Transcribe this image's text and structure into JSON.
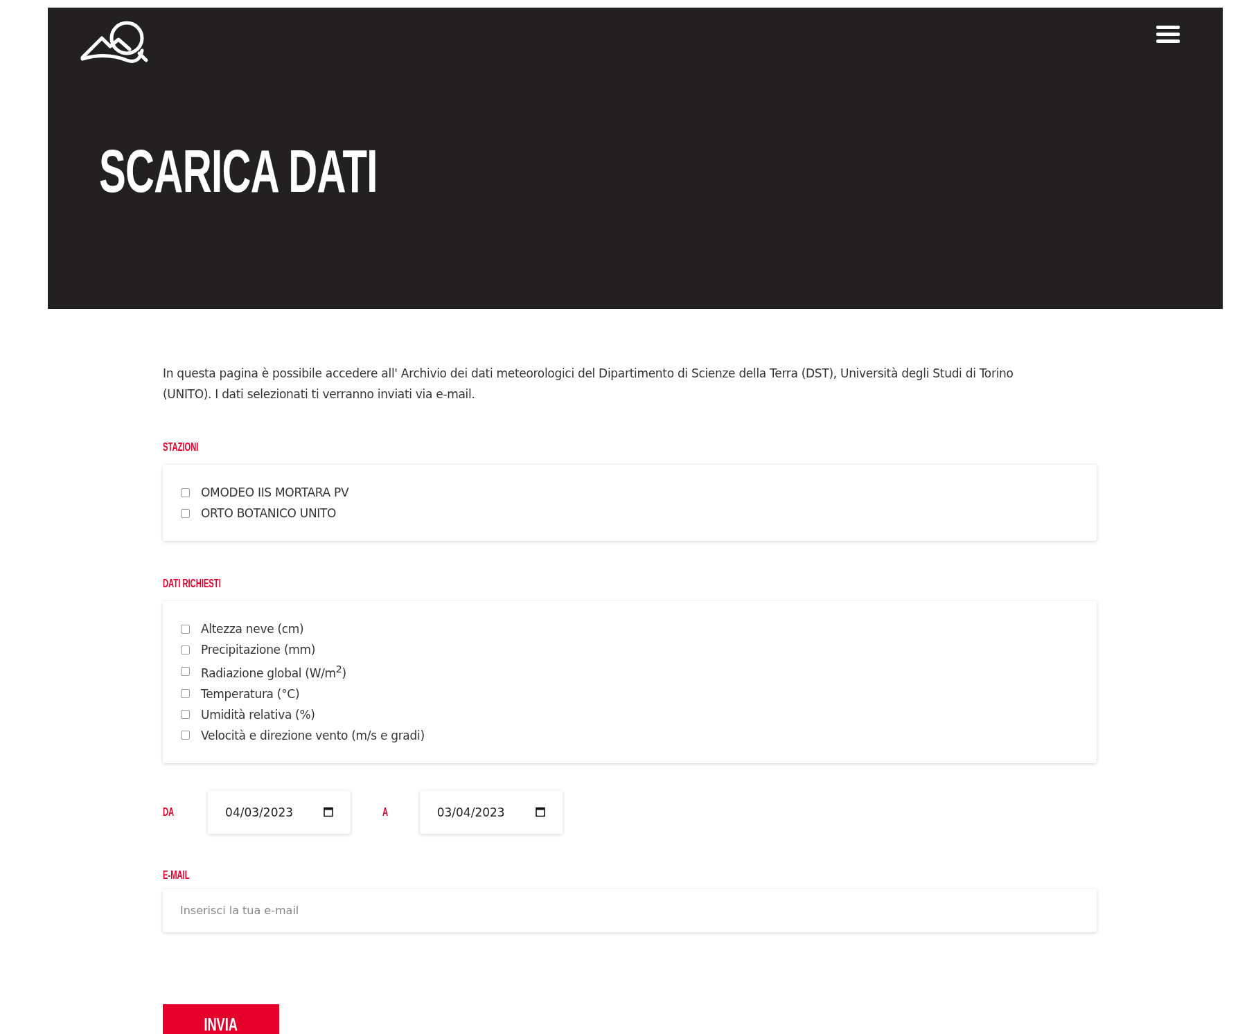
{
  "header": {
    "title": "SCARICA DATI"
  },
  "intro": "In questa pagina è possibile accedere all' Archivio dei dati meteorologici del Dipartimento di Scienze della Terra (DST), Università degli Studi di Torino (UNITO). I dati selezionati ti verranno inviati via e-mail.",
  "groups": [
    {
      "label": "STAZIONI",
      "options": [
        {
          "label": "OMODEO IIS MORTARA PV",
          "checked": false
        },
        {
          "label": "ORTO BOTANICO UNITO",
          "checked": false
        }
      ]
    },
    {
      "label": "DATI RICHIESTI",
      "options": [
        {
          "label": "Altezza neve (cm)",
          "checked": false
        },
        {
          "label": "Precipitazione (mm)",
          "checked": false
        },
        {
          "label": "Radiazione global (W/m$^{2}$)",
          "checked": false
        },
        {
          "label": "Temperatura (°C)",
          "checked": false
        },
        {
          "label": "Umidità relativa (%)",
          "checked": false
        },
        {
          "label": "Velocità e direzione vento (m/s e gradi)",
          "checked": false
        }
      ]
    }
  ],
  "dates": [
    {
      "label": "DA",
      "value": "04/03/2023"
    },
    {
      "label": "A",
      "value": "03/04/2023"
    }
  ],
  "email": {
    "label": "E-MAIL",
    "placeholder": "Inserisci la tua e-mail"
  },
  "submit": "INVIA"
}
